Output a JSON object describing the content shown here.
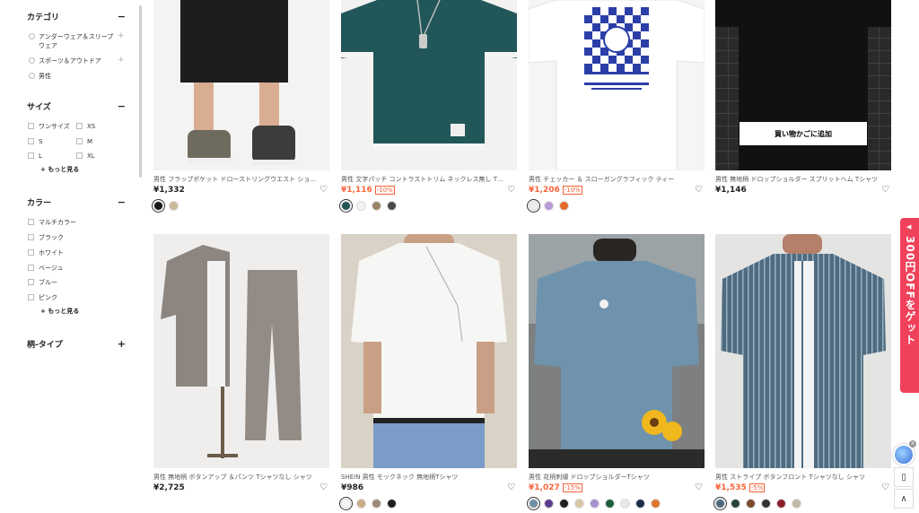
{
  "sidebar": {
    "category": {
      "title": "カテゴリ",
      "toggle": "−",
      "items": [
        {
          "line1": "アンダーウェア＆スリープ",
          "line2": "ウェア",
          "expand": "+"
        },
        {
          "line1": "スポーツ＆アウトドア",
          "expand": "+"
        },
        {
          "line1": "男性"
        }
      ]
    },
    "size": {
      "title": "サイズ",
      "toggle": "−",
      "items": [
        "ワンサイズ",
        "XS",
        "S",
        "M",
        "L",
        "XL"
      ],
      "more": "+ もっと見る"
    },
    "color": {
      "title": "カラー",
      "toggle": "−",
      "items": [
        "マルチカラー",
        "ブラック",
        "ホワイト",
        "ベージュ",
        "ブルー",
        "ピンク"
      ],
      "more": "+ もっと見る"
    },
    "pattern": {
      "title": "柄-タイプ",
      "toggle": "+"
    }
  },
  "products": [
    {
      "title": "男性 フラップポケット ドローストリングウエスト ショー...",
      "price": "¥1,332",
      "sale": false,
      "discount": "",
      "swatches": [
        "#1a1a1a",
        "#cbb99a"
      ],
      "image": "black shorts with sneakers"
    },
    {
      "title": "男性 文字パッチ コントラストトリム ネックレス無し Tシ...",
      "price": "¥1,116",
      "sale": true,
      "discount": "-10%",
      "swatches": [
        "#22575a",
        "#f1f1f1",
        "#9a8466",
        "#4a4a4a"
      ],
      "image": "teal t-shirt"
    },
    {
      "title": "男性 チェッカー ＆ スローガングラフィック ティー",
      "price": "¥1,206",
      "sale": true,
      "discount": "-10%",
      "swatches": [
        "#eeeeee",
        "#b79ad8",
        "#e56a2a"
      ],
      "image": "white checker graphic tee"
    },
    {
      "title": "男性 無地柄 ドロップショルダー スプリットヘム Tシャツ",
      "price": "¥1,146",
      "sale": false,
      "discount": "",
      "swatches": [],
      "image": "black tee",
      "cart_label": "買い物かごに追加"
    },
    {
      "title": "男性 無地柄 ボタンアップ ＆パンツ Tシャツなし シャツ",
      "price": "¥2,725",
      "sale": false,
      "discount": "",
      "swatches": [],
      "image": "grey shirt and pants set"
    },
    {
      "title": "SHEIN 男性 モックネック 無地柄Tシャツ",
      "price": "¥986",
      "sale": false,
      "discount": "",
      "swatches": [
        "#f6f6f6",
        "#c9ab86",
        "#9b8c77",
        "#1d1d1d"
      ],
      "image": "white mock neck tee"
    },
    {
      "title": "男性 花柄刺繍 ドロップショルダーTシャツ",
      "price": "¥1,027",
      "sale": true,
      "discount": "-15%",
      "swatches": [
        "#6e8fa6",
        "#5b3c8e",
        "#1d1d1d",
        "#d9c7a8",
        "#a88fcf",
        "#1f5e3a",
        "#e8e8e8",
        "#1f2a4a",
        "#e0732c"
      ],
      "image": "blue tee with flowers"
    },
    {
      "title": "男性 ストライプ ボタンフロント Tシャツなし シャツ",
      "price": "¥1,535",
      "sale": true,
      "discount": "-5%",
      "swatches": [
        "#4e6b80",
        "#24453c",
        "#7a4a2c",
        "#333333",
        "#8a1f2a",
        "#c2b8a8"
      ],
      "image": "striped blue shirt"
    }
  ],
  "promo": {
    "text": "300円OFFをゲット",
    "arrow": "◀"
  },
  "rail": {
    "copy_icon": "▯",
    "top_icon": "∧"
  },
  "colors": {
    "sale": "#fa6338",
    "promo": "#f0415a"
  }
}
